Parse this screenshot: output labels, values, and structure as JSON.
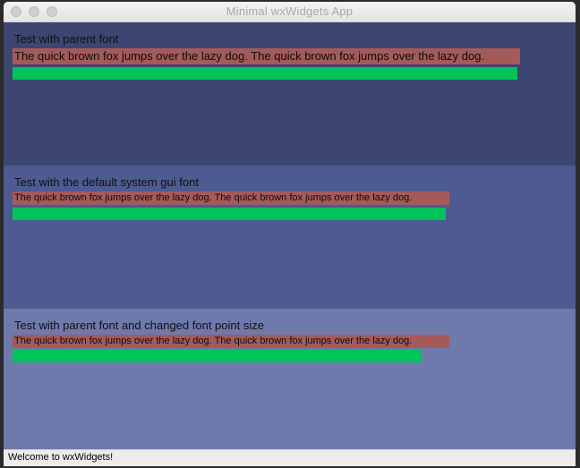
{
  "window": {
    "title": "Minimal wxWidgets App"
  },
  "panels": [
    {
      "label": "Test with parent font",
      "sample_text": "The quick brown fox jumps over the lazy dog. The quick brown fox jumps over the lazy dog.",
      "background": "#3d4571"
    },
    {
      "label": "Test with the default system gui font",
      "sample_text": "The quick brown fox jumps over the lazy dog. The quick brown fox jumps over the lazy dog.",
      "background": "#4e5a92"
    },
    {
      "label": "Test with parent font and changed font point size",
      "sample_text": "The quick brown fox jumps over the lazy dog. The quick brown fox jumps over the lazy dog.",
      "background": "#7079ab"
    }
  ],
  "colors": {
    "text_highlight": "#a55a5a",
    "bar": "#00c45a"
  },
  "statusbar": {
    "text": "Welcome to wxWidgets!"
  }
}
